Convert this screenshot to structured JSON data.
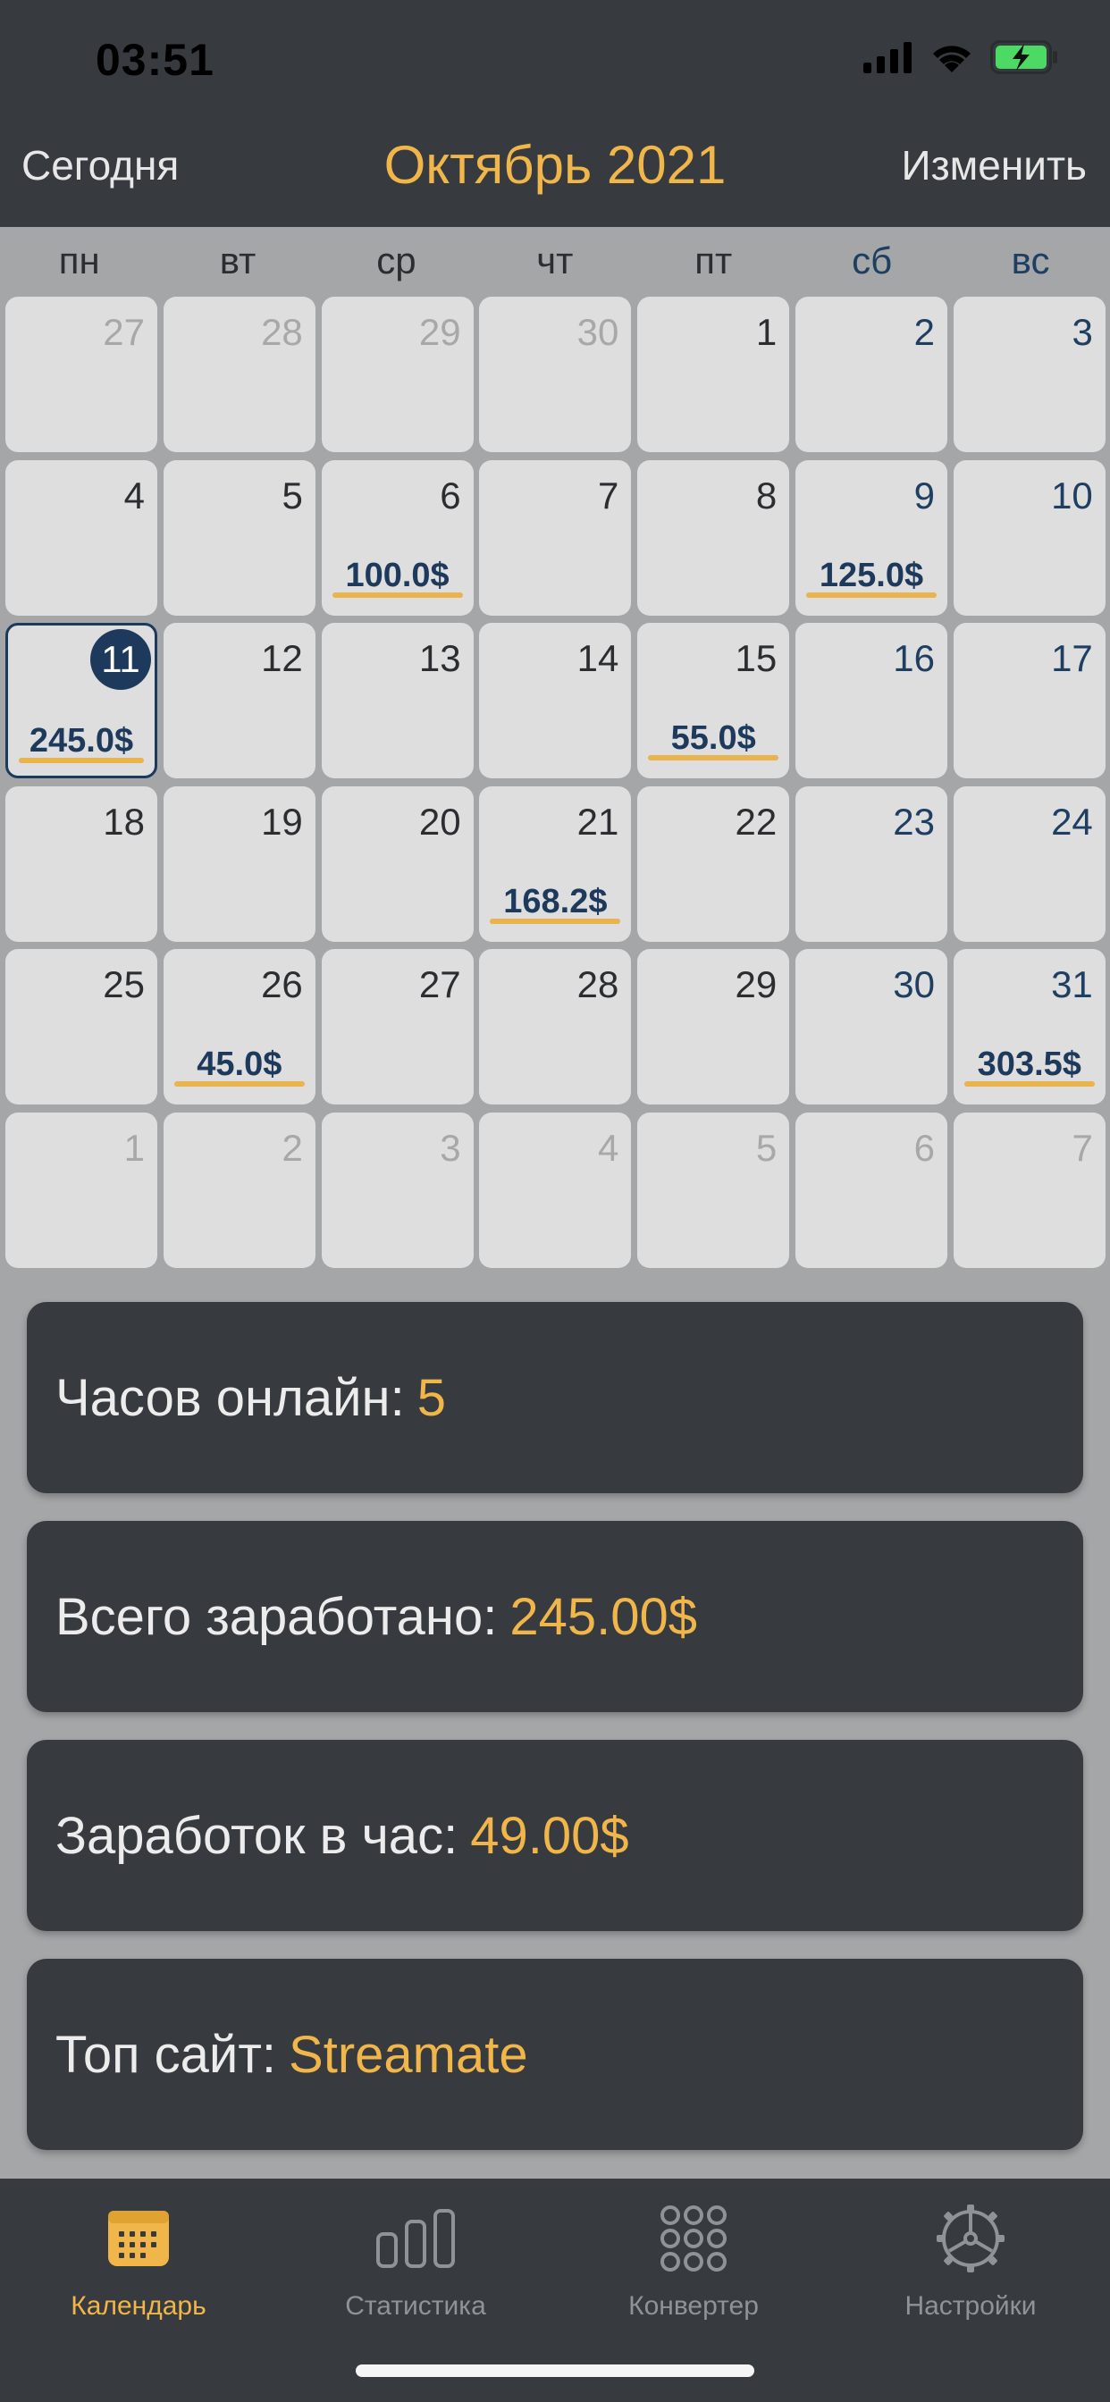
{
  "status_bar": {
    "time": "03:51"
  },
  "header": {
    "today_button": "Сегодня",
    "title": "Октябрь 2021",
    "edit_button": "Изменить"
  },
  "weekdays": [
    "пн",
    "вт",
    "ср",
    "чт",
    "пт",
    "сб",
    "вс"
  ],
  "calendar": {
    "days": [
      {
        "day": "27",
        "muted": true
      },
      {
        "day": "28",
        "muted": true
      },
      {
        "day": "29",
        "muted": true
      },
      {
        "day": "30",
        "muted": true
      },
      {
        "day": "1"
      },
      {
        "day": "2"
      },
      {
        "day": "3"
      },
      {
        "day": "4"
      },
      {
        "day": "5"
      },
      {
        "day": "6",
        "earning": "100.0$"
      },
      {
        "day": "7"
      },
      {
        "day": "8"
      },
      {
        "day": "9",
        "earning": "125.0$"
      },
      {
        "day": "10"
      },
      {
        "day": "11",
        "earning": "245.0$",
        "today": true
      },
      {
        "day": "12"
      },
      {
        "day": "13"
      },
      {
        "day": "14"
      },
      {
        "day": "15",
        "earning": "55.0$"
      },
      {
        "day": "16"
      },
      {
        "day": "17"
      },
      {
        "day": "18"
      },
      {
        "day": "19"
      },
      {
        "day": "20"
      },
      {
        "day": "21",
        "earning": "168.2$"
      },
      {
        "day": "22"
      },
      {
        "day": "23"
      },
      {
        "day": "24"
      },
      {
        "day": "25"
      },
      {
        "day": "26",
        "earning": "45.0$"
      },
      {
        "day": "27"
      },
      {
        "day": "28"
      },
      {
        "day": "29"
      },
      {
        "day": "30"
      },
      {
        "day": "31",
        "earning": "303.5$"
      },
      {
        "day": "1",
        "muted": true
      },
      {
        "day": "2",
        "muted": true
      },
      {
        "day": "3",
        "muted": true
      },
      {
        "day": "4",
        "muted": true
      },
      {
        "day": "5",
        "muted": true
      },
      {
        "day": "6",
        "muted": true
      },
      {
        "day": "7",
        "muted": true
      }
    ]
  },
  "stats": [
    {
      "label": "Часов онлайн:",
      "value": "5"
    },
    {
      "label": "Всего заработано:",
      "value": "245.00$"
    },
    {
      "label": "Заработок в час:",
      "value": "49.00$"
    },
    {
      "label": "Топ сайт:",
      "value": "Streamate"
    }
  ],
  "tabbar": {
    "tabs": [
      {
        "label": "Календарь",
        "icon": "calendar-icon",
        "active": true
      },
      {
        "label": "Статистика",
        "icon": "stats-icon"
      },
      {
        "label": "Конвертер",
        "icon": "converter-icon"
      },
      {
        "label": "Настройки",
        "icon": "settings-icon"
      }
    ]
  },
  "colors": {
    "accent": "#f0b649",
    "dark": "#373a3e",
    "navy": "#1d3a5c",
    "battery": "#4cd964"
  }
}
